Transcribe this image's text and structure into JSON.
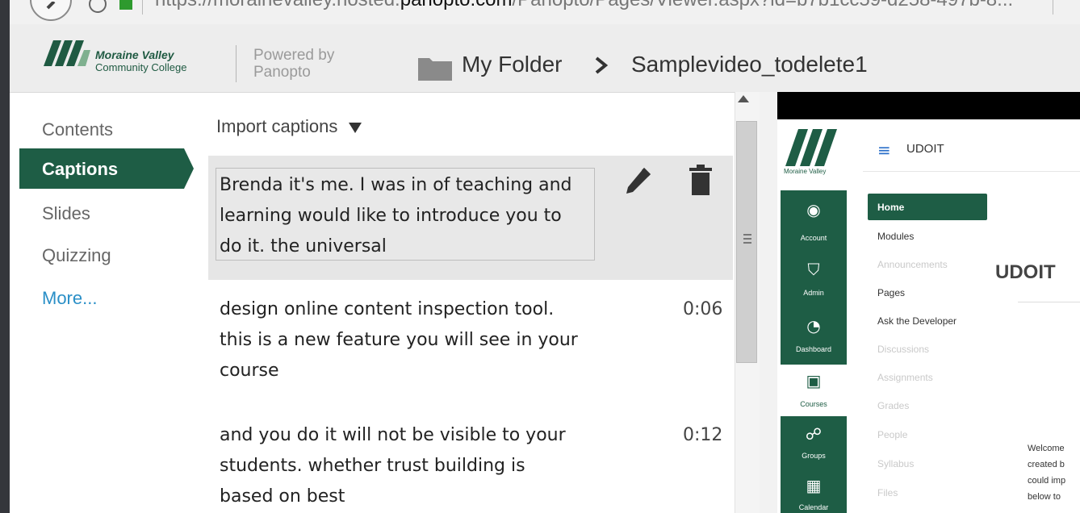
{
  "browser": {
    "url_prefix": "https://morainevalley.hosted.",
    "url_domain": "panopto.com",
    "url_suffix": "/Panopto/Pages/Viewer.aspx?id=b7b1cc59-d258-497b-8..."
  },
  "header": {
    "logo_line1": "Moraine Valley",
    "logo_line2": "Community College",
    "powered_line1": "Powered by",
    "powered_line2": "Panopto",
    "breadcrumb_folder": "My Folder",
    "breadcrumb_video": "Samplevideo_todelete1"
  },
  "sidebar": {
    "items": [
      {
        "label": "Contents"
      },
      {
        "label": "Captions"
      },
      {
        "label": "Slides"
      },
      {
        "label": "Quizzing"
      },
      {
        "label": "More..."
      }
    ]
  },
  "captions": {
    "import_label": "Import captions",
    "entries": [
      {
        "lines": [
          "Brenda it's me. I was in of teaching and",
          "learning would like to introduce you to",
          "do it. the universal"
        ],
        "time": ""
      },
      {
        "lines": [
          "design online content inspection tool.",
          "this is a new feature you will see in your",
          "course"
        ],
        "time": "0:06"
      },
      {
        "lines": [
          "and you do it will not be visible to your",
          "students. whether trust building is",
          "based on best"
        ],
        "time": "0:12"
      }
    ]
  },
  "video": {
    "rail_logo_text": "Moraine Valley",
    "rail": [
      "Account",
      "Admin",
      "Dashboard",
      "Courses",
      "Groups",
      "Calendar"
    ],
    "app_title": "UDOIT",
    "menu": [
      "Home",
      "Modules",
      "Announcements",
      "Pages",
      "Ask the Developer",
      "Discussions",
      "Assignments",
      "Grades",
      "People",
      "Syllabus",
      "Files"
    ],
    "page_heading": "UDOIT",
    "welcome_lines": [
      "Welcome",
      "created b",
      "could imp",
      "below to"
    ]
  }
}
